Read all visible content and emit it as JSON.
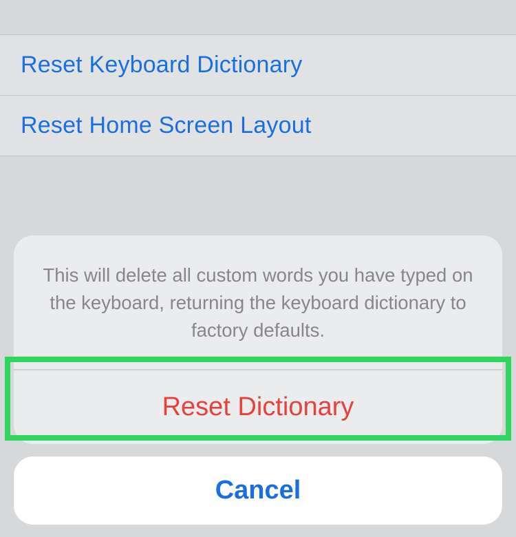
{
  "settings": {
    "rows": [
      {
        "label": "Reset Keyboard Dictionary"
      },
      {
        "label": "Reset Home Screen Layout"
      }
    ]
  },
  "actionSheet": {
    "message": "This will delete all custom words you have typed on the keyboard, returning the keyboard dictionary to factory defaults.",
    "destructiveLabel": "Reset Dictionary",
    "cancelLabel": "Cancel"
  }
}
